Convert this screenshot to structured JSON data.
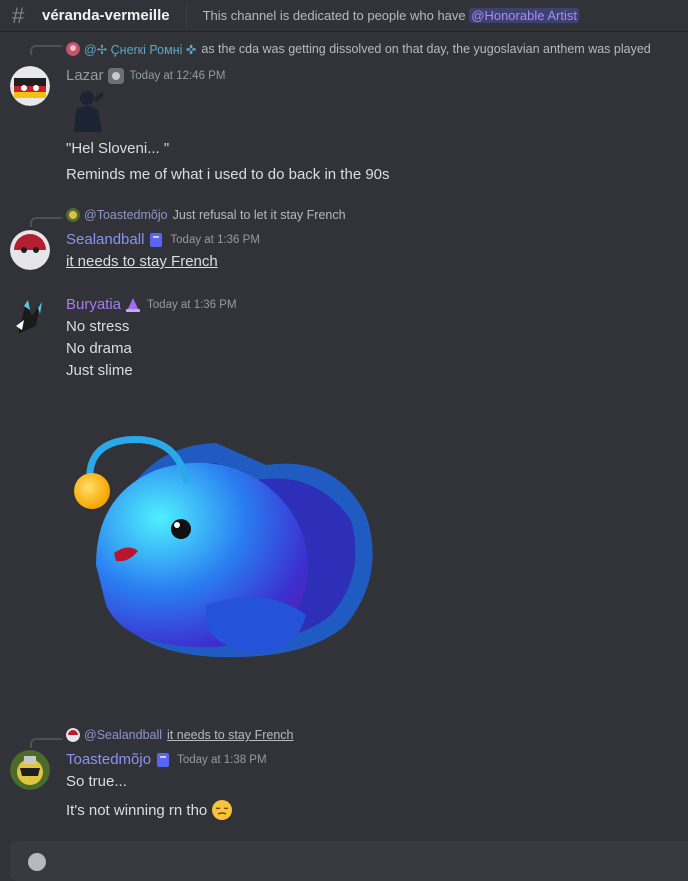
{
  "channel": {
    "name": "véranda-vermeille",
    "topic_prefix": "This channel is dedicated to people who have ",
    "topic_mention": "@Honorable Artist"
  },
  "messages": [
    {
      "reply": {
        "name": "@✢ Ҫнеrкі Ромні ✜",
        "text": "as the cda was getting dissolved on that day, the yugoslavian anthem was played"
      },
      "author": "Lazar",
      "author_color": "#949ba4",
      "timestamp": "Today at 12:46 PM",
      "lines": [
        "\"Hel Sloveni... \"",
        "Reminds me of what i used to do back in the 90s"
      ]
    },
    {
      "reply": {
        "name": "@Toastedmõjo",
        "text": "Just refusal to let it stay French"
      },
      "author": "Sealandball",
      "author_color": "#8b93f0",
      "timestamp": "Today at 1:36 PM",
      "lines": [
        "it needs to stay French"
      ]
    },
    {
      "author": "Buryatia",
      "author_color": "#a67cf2",
      "timestamp": "Today at 1:36 PM",
      "lines": [
        "No stress",
        "No drama",
        "Just slime"
      ]
    },
    {
      "reply": {
        "name": "@Sealandball",
        "text": "it needs to stay French"
      },
      "author": "Toastedmõjo",
      "author_color": "#8b93f0",
      "timestamp": "Today at 1:38 PM",
      "lines": [
        "So true...",
        "It's not winning rn tho"
      ]
    }
  ],
  "icons": {
    "channel": "hashtag-icon",
    "emoji": "pensive-face-emoji"
  }
}
